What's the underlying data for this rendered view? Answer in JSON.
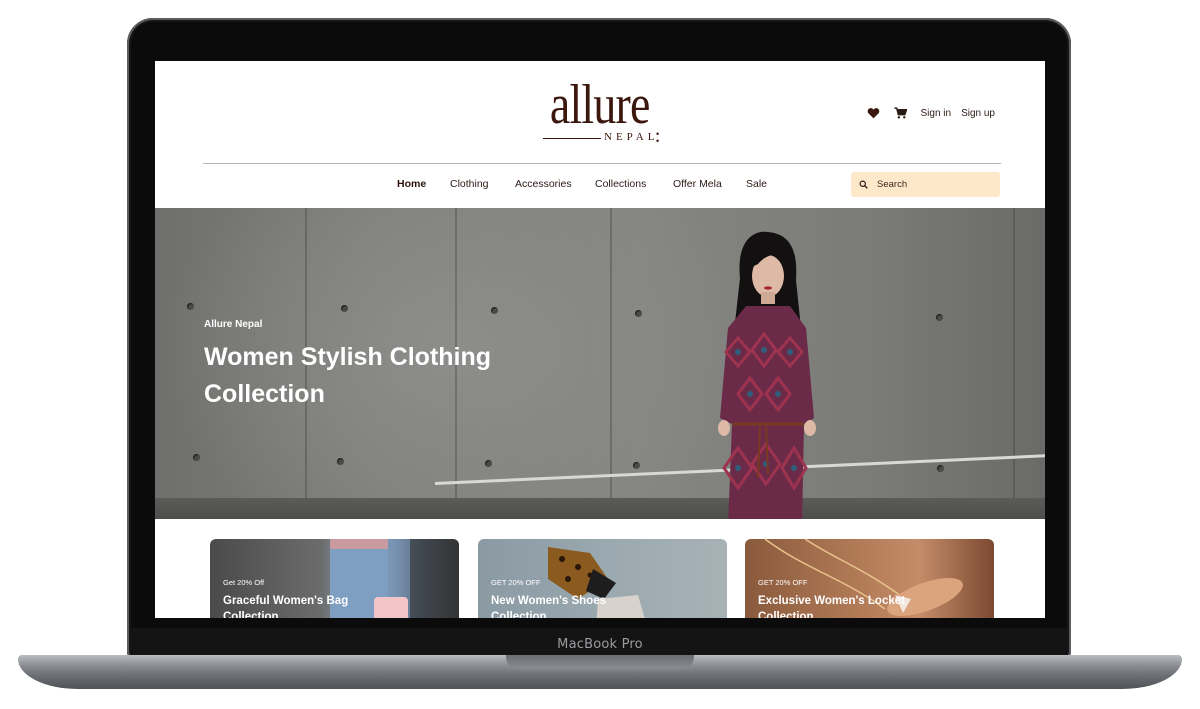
{
  "device": {
    "model_label": "MacBook Pro"
  },
  "brand": {
    "logo_word": "allure",
    "logo_sub": "NEPAL"
  },
  "header": {
    "sign_in": "Sign in",
    "sign_up": "Sign up",
    "icons": [
      "heart-icon",
      "cart-icon"
    ]
  },
  "nav": {
    "items": [
      {
        "label": "Home",
        "active": true
      },
      {
        "label": "Clothing"
      },
      {
        "label": "Accessories"
      },
      {
        "label": "Collections"
      },
      {
        "label": "Offer Mela"
      },
      {
        "label": "Sale"
      }
    ]
  },
  "search": {
    "placeholder": "Search"
  },
  "hero": {
    "subtitle": "Allure Nepal",
    "title": "Women Stylish Clothing Collection"
  },
  "cards": [
    {
      "tag": "Get 20% Off",
      "title": "Graceful Women's Bag Collection"
    },
    {
      "tag": "GET 20% OFF",
      "title": "New Women's Shoes Collection"
    },
    {
      "tag": "GET 20% OFF",
      "title": "Exclusive Women's Locket Collection"
    }
  ],
  "colors": {
    "brand": "#3b170d",
    "search_bg": "#fde8c9",
    "text_dark": "#2a1a14"
  }
}
